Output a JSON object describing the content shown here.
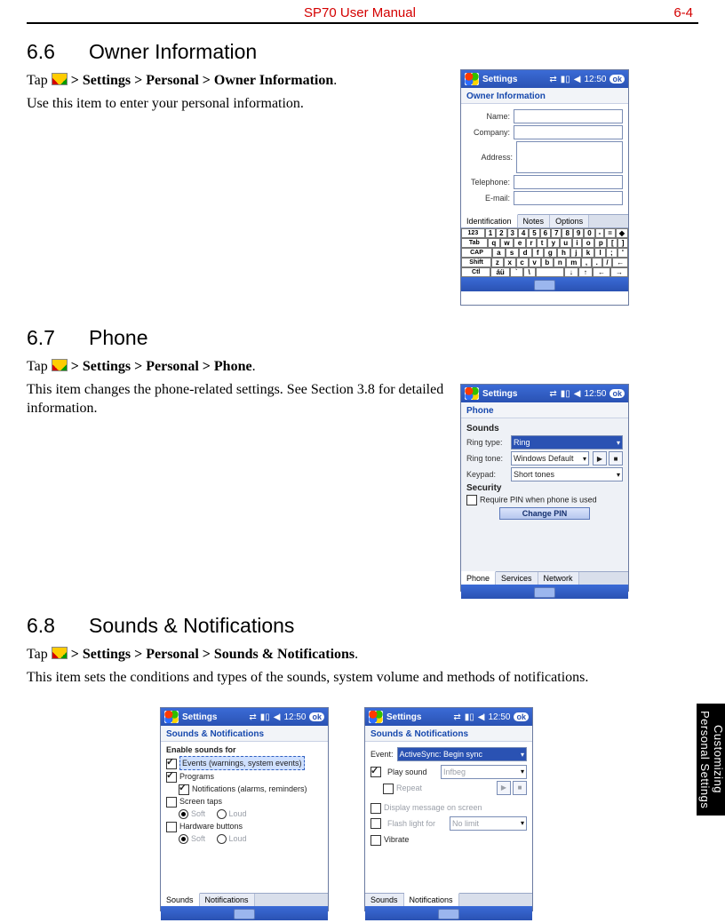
{
  "header": {
    "center": "SP70 User Manual",
    "right": "6-4"
  },
  "side_tab": {
    "line1": "Customizing",
    "line2": "Personal Settings"
  },
  "s66": {
    "num": "6.6",
    "title": "Owner Information",
    "tap": "Tap",
    "path": " > Settings > Personal > Owner Information",
    "dot": ".",
    "desc": "Use this item to enter your personal information."
  },
  "s67": {
    "num": "6.7",
    "title": "Phone",
    "tap": "Tap",
    "path": " > Settings > Personal > Phone",
    "dot": ".",
    "desc": "This item changes the phone-related settings. See Section 3.8 for detailed information."
  },
  "s68": {
    "num": "6.8",
    "title": "Sounds & Notifications",
    "tap": "Tap",
    "path": " > Settings > Personal > Sounds & Notifications",
    "dot": ".",
    "desc": "This item sets the conditions and types of the sounds, system volume and methods of notifications."
  },
  "taskbar": {
    "title": "Settings",
    "time": "12:50",
    "ok": "ok"
  },
  "owner_shot": {
    "header": "Owner Information",
    "name": "Name:",
    "company": "Company:",
    "address": "Address:",
    "telephone": "Telephone:",
    "email": "E-mail:",
    "tabs": [
      "Identification",
      "Notes",
      "Options"
    ],
    "kb": {
      "r1": [
        "123",
        "1",
        "2",
        "3",
        "4",
        "5",
        "6",
        "7",
        "8",
        "9",
        "0",
        "-",
        "=",
        "◆"
      ],
      "r2": [
        "Tab",
        "q",
        "w",
        "e",
        "r",
        "t",
        "y",
        "u",
        "i",
        "o",
        "p",
        "[",
        "]"
      ],
      "r3": [
        "CAP",
        "a",
        "s",
        "d",
        "f",
        "g",
        "h",
        "j",
        "k",
        "l",
        ";",
        "'"
      ],
      "r4": [
        "Shift",
        "z",
        "x",
        "c",
        "v",
        "b",
        "n",
        "m",
        ",",
        ".",
        "/",
        "←"
      ],
      "r5": [
        "Ctl",
        "áü",
        "` ",
        "\\",
        " ",
        "↓",
        "↑",
        "←",
        "→"
      ]
    }
  },
  "phone_shot": {
    "header": "Phone",
    "sounds": "Sounds",
    "ring_type_lbl": "Ring type:",
    "ring_type_val": "Ring",
    "ring_tone_lbl": "Ring tone:",
    "ring_tone_val": "Windows Default",
    "keypad_lbl": "Keypad:",
    "keypad_val": "Short tones",
    "security": "Security",
    "require_pin": "Require PIN when phone is used",
    "change_pin": "Change PIN",
    "tabs": [
      "Phone",
      "Services",
      "Network"
    ]
  },
  "snd_shot_a": {
    "header": "Sounds & Notifications",
    "enable": "Enable sounds for",
    "events": "Events (warnings, system events)",
    "programs": "Programs",
    "notifs": "Notifications (alarms, reminders)",
    "screen_taps": "Screen taps",
    "hw_buttons": "Hardware buttons",
    "soft": "Soft",
    "loud": "Loud",
    "tabs": [
      "Sounds",
      "Notifications"
    ]
  },
  "snd_shot_b": {
    "header": "Sounds & Notifications",
    "event_lbl": "Event:",
    "event_val": "ActiveSync: Begin sync",
    "play_sound": "Play sound",
    "play_sound_val": "Infbeg",
    "repeat": "Repeat",
    "display_msg": "Display message on screen",
    "flash_lbl": "Flash light for",
    "flash_val": "No limit",
    "vibrate": "Vibrate",
    "tabs": [
      "Sounds",
      "Notifications"
    ]
  }
}
